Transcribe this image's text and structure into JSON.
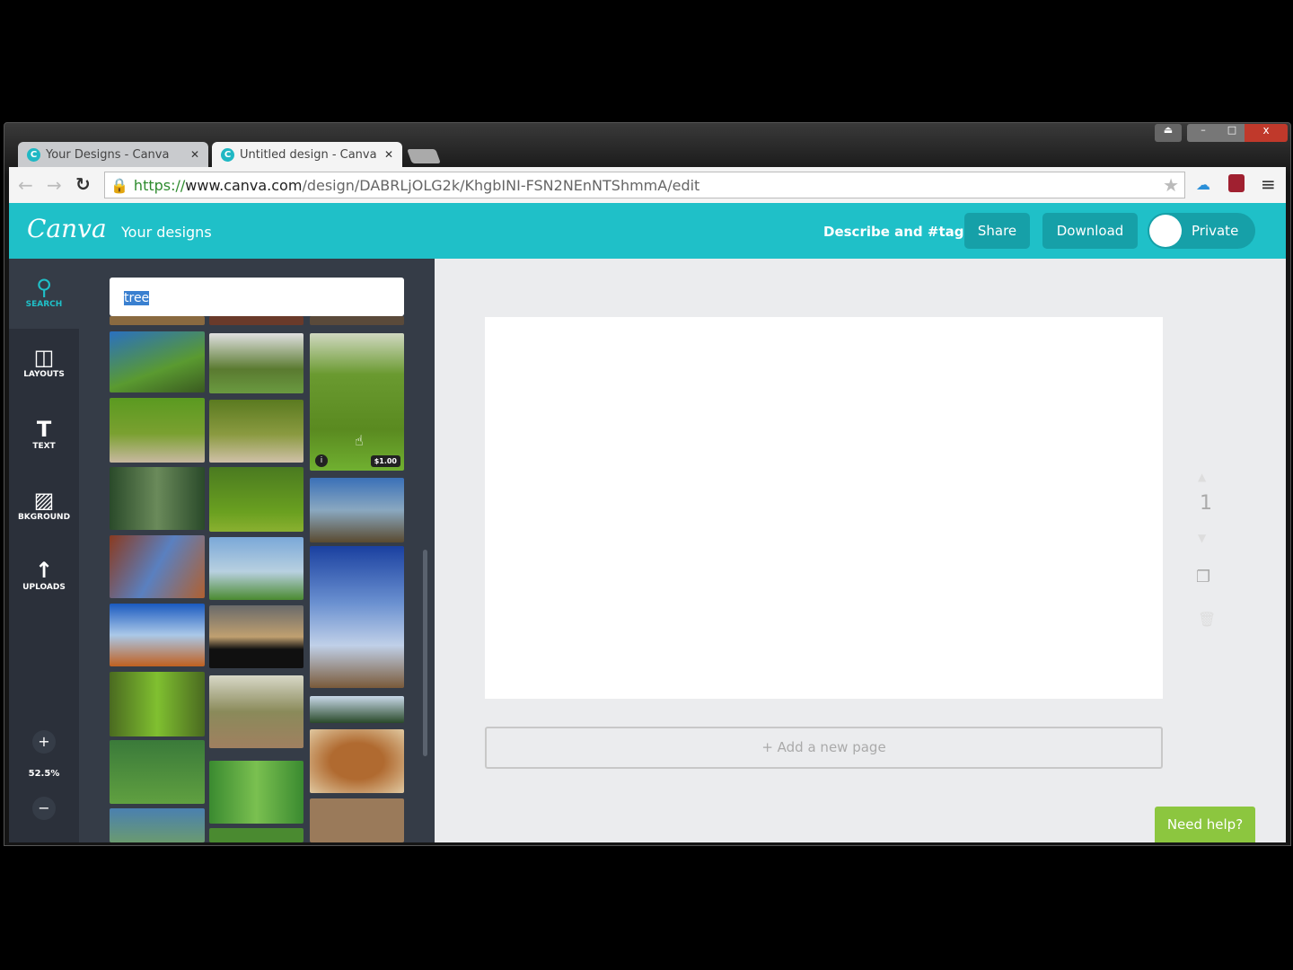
{
  "browser": {
    "tabs": [
      {
        "label": "Your Designs - Canva",
        "active": false
      },
      {
        "label": "Untitled design - Canva",
        "active": true
      }
    ],
    "url_https": "https://",
    "url_host": "www.canva.com",
    "url_path": "/design/DABRLjOLG2k/KhgbINI-FSN2NEnNTShmmA/edit"
  },
  "header": {
    "logo": "Canva",
    "your_designs": "Your designs",
    "describe": "Describe and #tag",
    "share": "Share",
    "download": "Download",
    "private": "Private",
    "accent": "#1fc0c8"
  },
  "sidebar": {
    "items": [
      {
        "label": "SEARCH",
        "icon": "search-icon"
      },
      {
        "label": "LAYOUTS",
        "icon": "layouts-icon"
      },
      {
        "label": "TEXT",
        "icon": "text-icon"
      },
      {
        "label": "BKGROUND",
        "icon": "background-icon"
      },
      {
        "label": "UPLOADS",
        "icon": "upload-icon"
      }
    ],
    "zoom": "52.5%"
  },
  "search": {
    "value": "tree"
  },
  "results": {
    "price": "$1.00",
    "info": "i"
  },
  "canvas": {
    "page_number": "1",
    "add_page": "+ Add a new page"
  },
  "help": "Need help?"
}
